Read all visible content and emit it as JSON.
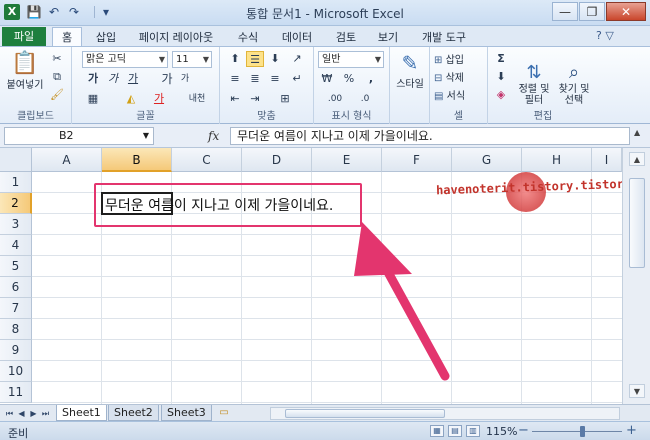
{
  "window": {
    "title": "통합 문서1 - Microsoft Excel",
    "app_icon": "X",
    "qat": {
      "save_icon": "💾",
      "undo_icon": "↶",
      "redo_icon": "↷",
      "customize_icon": "▾"
    },
    "controls": {
      "minimize": "—",
      "restore": "❐",
      "close": "✕"
    }
  },
  "ribbon_tabs": {
    "file": "파일",
    "items": [
      "홈",
      "삽입",
      "페이지 레이아웃",
      "수식",
      "데이터",
      "검토",
      "보기",
      "개발 도구"
    ],
    "active": "홈",
    "help_icon": "? ▽"
  },
  "ribbon": {
    "clipboard": {
      "paste_label": "붙여넣기",
      "group_label": "클립보드"
    },
    "font": {
      "font_name": "맑은 고딕",
      "font_size": "11",
      "bold": "가",
      "italic": "가",
      "underline": "가",
      "grow": "가",
      "shrink": "가",
      "phonetic": "내천",
      "font_color_glyph": "가",
      "group_label": "글꼴"
    },
    "alignment": {
      "group_label": "맞춤"
    },
    "number": {
      "format": "일반",
      "currency": "₩",
      "percent": "%",
      "comma": ",",
      "inc_dec": ".00",
      "dec_dec": ".0",
      "group_label": "표시 형식"
    },
    "styles": {
      "label": "스타일",
      "group_label": ""
    },
    "cells": {
      "insert": "삽입",
      "delete": "삭제",
      "format": "서식",
      "group_label": "셀"
    },
    "editing": {
      "sum_icon": "Σ",
      "sort_filter": "정렬 및\n필터",
      "find_select": "찾기 및\n선택",
      "group_label": "편집"
    }
  },
  "formula_bar": {
    "name_box": "B2",
    "fx": "fx",
    "value": "무더운 여름이 지나고 이제 가을이네요."
  },
  "grid": {
    "columns": [
      "A",
      "B",
      "C",
      "D",
      "E",
      "F",
      "G",
      "H",
      "I"
    ],
    "rows": [
      "1",
      "2",
      "3",
      "4",
      "5",
      "6",
      "7",
      "8",
      "9",
      "10",
      "11"
    ],
    "active_cell": "B2",
    "active_column": "B",
    "active_row": "2",
    "cell_b2_text": "무더운 여름이 지나고 이제 가을이네요.",
    "watermark_text": "havenoterit.tistory.tistory"
  },
  "sheets": {
    "tabs": [
      "Sheet1",
      "Sheet2",
      "Sheet3"
    ],
    "active": "Sheet1",
    "nav": [
      "⏮",
      "◀",
      "▶",
      "⏭"
    ]
  },
  "status": {
    "ready": "준비",
    "zoom": "115%",
    "zoom_minus": "−",
    "zoom_plus": "+"
  },
  "colors": {
    "highlight": "#e3356e",
    "file_tab": "#1e7f3e",
    "active_header": "#f5c979"
  }
}
